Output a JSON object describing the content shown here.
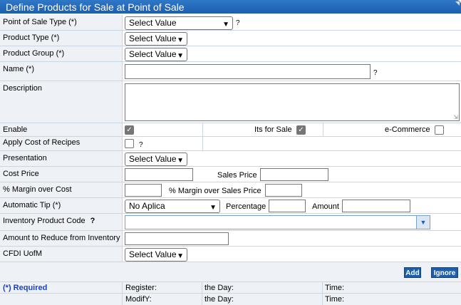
{
  "title": "Define Products for Sale at Point of Sale",
  "fields": {
    "point_of_sale_type": {
      "label": "Point of Sale Type (*)",
      "value": "Select Value",
      "help": "?"
    },
    "product_type": {
      "label": "Product Type (*)",
      "value": "Select Value"
    },
    "product_group": {
      "label": "Product Group (*)",
      "value": "Select Value"
    },
    "name": {
      "label": "Name (*)",
      "value": "",
      "help": "?"
    },
    "description": {
      "label": "Description",
      "value": ""
    },
    "enable": {
      "label": "Enable",
      "checked": true
    },
    "its_for_sale": {
      "label": "Its for Sale",
      "checked": true
    },
    "ecommerce": {
      "label": "e-Commerce",
      "checked": false
    },
    "apply_cost": {
      "label": "Apply Cost of Recipes",
      "checked": false,
      "help": "?"
    },
    "presentation": {
      "label": "Presentation",
      "value": "Select Value"
    },
    "cost_price": {
      "label": "Cost Price",
      "value": ""
    },
    "sales_price": {
      "label": "Sales Price",
      "value": ""
    },
    "margin_cost": {
      "label": "% Margin over Cost",
      "value": ""
    },
    "margin_sales": {
      "label": "% Margin over Sales Price",
      "value": ""
    },
    "automatic_tip": {
      "label": "Automatic Tip (*)",
      "value": "No Aplica"
    },
    "percentage": {
      "label": "Percentage",
      "value": ""
    },
    "amount": {
      "label": "Amount",
      "value": ""
    },
    "inventory_code": {
      "label": "Inventory Product Code",
      "help": "?",
      "value": ""
    },
    "amount_reduce": {
      "label": "Amount to Reduce from Inventory",
      "value": ""
    },
    "cfdi_uofm": {
      "label": "CFDI UofM",
      "value": "Select Value"
    }
  },
  "buttons": {
    "add": "Add",
    "ignore": "Ignore"
  },
  "footer": {
    "required": "(*) Required",
    "register": "Register:",
    "modify": "ModifY:",
    "the_day": "the Day:",
    "time": "Time:"
  },
  "colors": {
    "title_bar": "#1d5fae",
    "label_bg": "#eef2f7",
    "button": "#1f5ea8",
    "required_text": "#1a3fc4"
  }
}
